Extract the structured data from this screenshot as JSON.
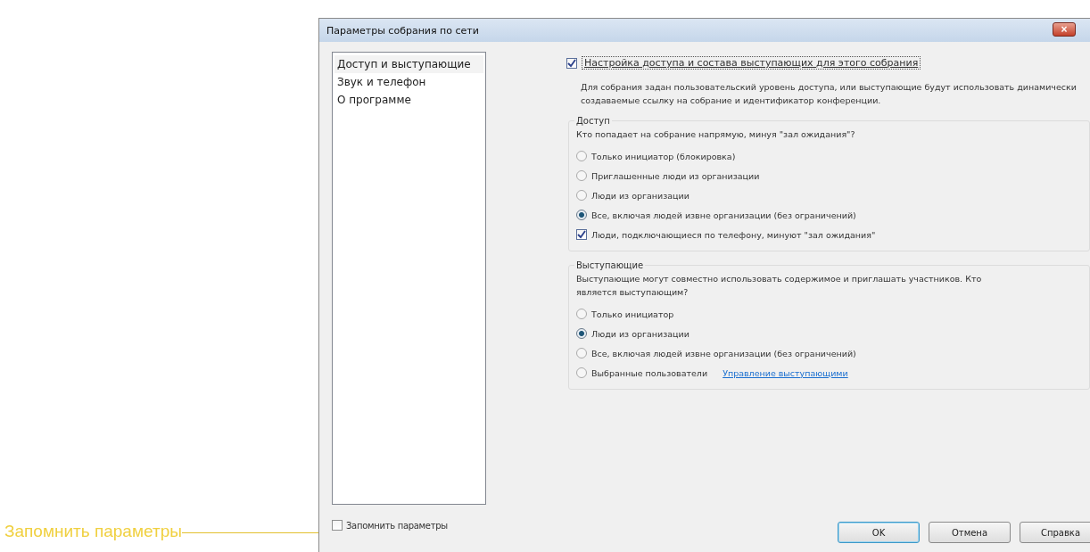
{
  "window": {
    "title": "Параметры собрания по сети",
    "close_glyph": "×"
  },
  "sidebar": {
    "items": [
      {
        "label": "Доступ и выступающие",
        "selected": true
      },
      {
        "label": "Звук и телефон",
        "selected": false
      },
      {
        "label": "О программе",
        "selected": false
      }
    ]
  },
  "customize": {
    "label": "Настройка доступа и состава выступающих для этого собрания",
    "checked": true
  },
  "description": "Для собрания задан пользовательский уровень доступа, или выступающие будут использовать динамически создаваемые ссылку на собрание и идентификатор конференции.",
  "groups": [
    {
      "title": "Доступ",
      "question": "Кто попадает на собрание напрямую, минуя \"зал ожидания\"?",
      "options": [
        {
          "kind": "radio",
          "label": "Только инициатор (блокировка)",
          "selected": false
        },
        {
          "kind": "radio",
          "label": "Приглашенные люди из организации",
          "selected": false
        },
        {
          "kind": "radio",
          "label": "Люди из организации",
          "selected": false
        },
        {
          "kind": "radio",
          "label": "Все, включая людей извне организации (без ограничений)",
          "selected": true
        },
        {
          "kind": "checkbox",
          "label": "Люди, подключающиеся по телефону, минуют \"зал ожидания\"",
          "checked": true
        }
      ]
    },
    {
      "title": "Выступающие",
      "question": "Выступающие могут совместно использовать содержимое и приглашать участников. Кто является выступающим?",
      "options": [
        {
          "kind": "radio",
          "label": "Только инициатор",
          "selected": false
        },
        {
          "kind": "radio",
          "label": "Люди из организации",
          "selected": true
        },
        {
          "kind": "radio",
          "label": "Все, включая людей извне организации (без ограничений)",
          "selected": false
        },
        {
          "kind": "radio",
          "label": "Выбранные пользователи",
          "selected": false,
          "link": "Управление выступающими"
        }
      ]
    }
  ],
  "remember": {
    "label": "Запомнить параметры",
    "checked": false
  },
  "buttons": [
    {
      "label": "OK",
      "default": true
    },
    {
      "label": "Отмена",
      "default": false
    },
    {
      "label": "Справка",
      "default": false
    }
  ],
  "callout": {
    "label": "Запомнить параметры"
  }
}
